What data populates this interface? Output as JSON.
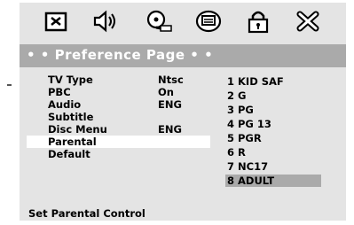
{
  "toolbar": {
    "icons": [
      "general-setup-icon",
      "audio-speaker-icon",
      "video-film-icon",
      "preference-icon",
      "password-lock-icon",
      "exit-icon"
    ]
  },
  "header": {
    "title": "• • Preference Page • •"
  },
  "menu": {
    "items": [
      {
        "label": "TV Type",
        "value": "Ntsc"
      },
      {
        "label": "PBC",
        "value": "On"
      },
      {
        "label": "Audio",
        "value": "ENG"
      },
      {
        "label": "Subtitle",
        "value": ""
      },
      {
        "label": "Disc Menu",
        "value": "ENG"
      },
      {
        "label": "Parental",
        "value": ""
      },
      {
        "label": "Default",
        "value": ""
      }
    ],
    "selected_index": 5
  },
  "options": {
    "items": [
      "1 KID SAF",
      "2 G",
      "3 PG",
      "4 PG 13",
      "5 PGR",
      "6 R",
      "7 NC17",
      "8 ADULT"
    ],
    "selected_index": 7
  },
  "status": {
    "text": "Set Parental Control"
  },
  "colors": {
    "panel": "#e4e4e4",
    "highlight": "#aaaaaa",
    "selected_row": "#ffffff"
  }
}
